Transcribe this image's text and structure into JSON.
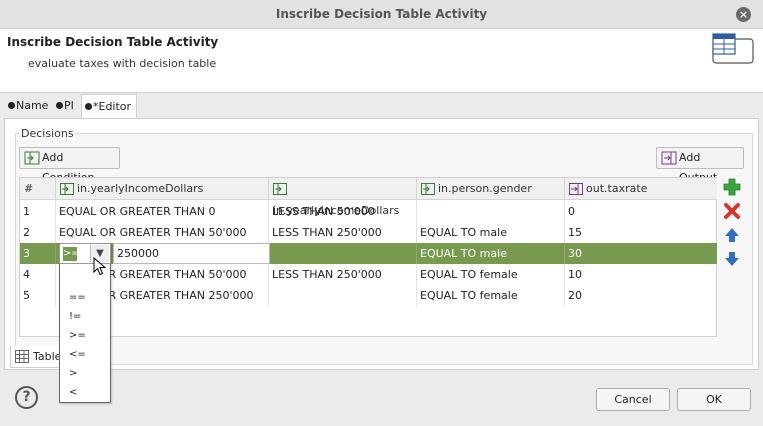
{
  "window": {
    "title": "Inscribe Decision Table Activity",
    "close_glyph": "×"
  },
  "header": {
    "title": "Inscribe Decision Table Activity",
    "description": "evaluate taxes with decision table"
  },
  "tabs": [
    {
      "label": "Name",
      "prefix": ""
    },
    {
      "label": "PI",
      "prefix": ""
    },
    {
      "label": "Editor",
      "prefix": "*"
    }
  ],
  "decisions": {
    "group_label": "Decisions",
    "add_condition_label": "Add Condition",
    "add_output_label": "Add Output",
    "columns": [
      "#",
      "in.yearlyIncomeDollars",
      "in.yearlyIncomeDollars",
      "in.person.gender",
      "out.taxrate"
    ],
    "rows": [
      [
        "1",
        "EQUAL OR GREATER THAN 0",
        "LESS THAN 50'000",
        "",
        "0"
      ],
      [
        "2",
        "EQUAL OR GREATER THAN 50'000",
        "LESS THAN 250'000",
        "EQUAL TO male",
        "15"
      ],
      [
        "3",
        "",
        "",
        "EQUAL TO male",
        "30"
      ],
      [
        "4",
        "EQUAL OR GREATER THAN 50'000",
        "LESS THAN 250'000",
        "EQUAL TO female",
        "10"
      ],
      [
        "5",
        "EQUAL OR GREATER THAN 250'000",
        "",
        "EQUAL TO female",
        "20"
      ]
    ],
    "selected_row_index": 2
  },
  "editor": {
    "operator_value": ">=",
    "operator_options": [
      "==",
      "!=",
      ">=",
      "<=",
      ">",
      "<"
    ],
    "value_input": "250000"
  },
  "bottom_tab": {
    "label": "Table"
  },
  "footer": {
    "help_glyph": "?",
    "cancel_label": "Cancel",
    "ok_label": "OK"
  },
  "colors": {
    "selection": "#779a4f",
    "add": "#3aa63a",
    "remove": "#d9362b",
    "arrow": "#2f6fc4"
  }
}
